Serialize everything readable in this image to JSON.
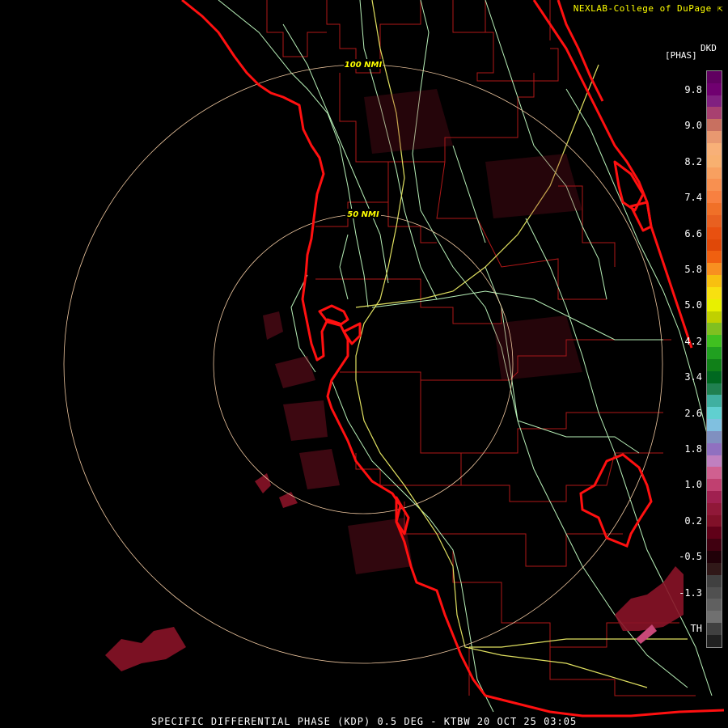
{
  "credit": "NEXLAB-College of DuPage",
  "credit_icon": "cursor-arrow-icon",
  "product_code": "DKD",
  "units": "[PHAS]",
  "footer": "SPECIFIC DIFFERENTIAL PHASE (KDP) 0.5 DEG - KTBW 20 OCT 25 03:05",
  "rings": [
    {
      "label": "100 NMI"
    },
    {
      "label": "50 NMI"
    }
  ],
  "legend": {
    "labels": [
      "9.8",
      "9.0",
      "8.2",
      "7.4",
      "6.6",
      "5.8",
      "5.0",
      "4.2",
      "3.4",
      "2.6",
      "1.8",
      "1.0",
      "0.2",
      "-0.5",
      "-1.3",
      "TH"
    ],
    "colors": [
      "#600060",
      "#700070",
      "#802080",
      "#a84070",
      "#c87060",
      "#e89870",
      "#f8b078",
      "#f8b070",
      "#f8a060",
      "#f89050",
      "#f88040",
      "#f07028",
      "#e86020",
      "#e85010",
      "#e04808",
      "#f06010",
      "#f89020",
      "#f8c010",
      "#f8e010",
      "#e8f000",
      "#c0d000",
      "#80c020",
      "#40c020",
      "#20a020",
      "#108018",
      "#006820",
      "#208050",
      "#40b0a0",
      "#60d0d0",
      "#80c0e0",
      "#8090c0",
      "#9070c0",
      "#c080c0",
      "#d06090",
      "#c04070",
      "#a02050",
      "#901838",
      "#801028",
      "#600018",
      "#400010",
      "#200008",
      "#301818",
      "#404040",
      "#505050",
      "#606060",
      "#707070",
      "#404040",
      "#202020"
    ],
    "text_color": "#ffffff",
    "border_color": "#888888"
  },
  "colors": {
    "background": "#000000",
    "coast": "#ff1010",
    "county": "#b01818",
    "roads": "#b8f0b8",
    "interstates": "#e0e060",
    "rings": "#f0c8a0",
    "ring_label": "#ffff00",
    "credit": "#ffff00",
    "footer": "#ffffff",
    "echo": "#8a1428"
  }
}
